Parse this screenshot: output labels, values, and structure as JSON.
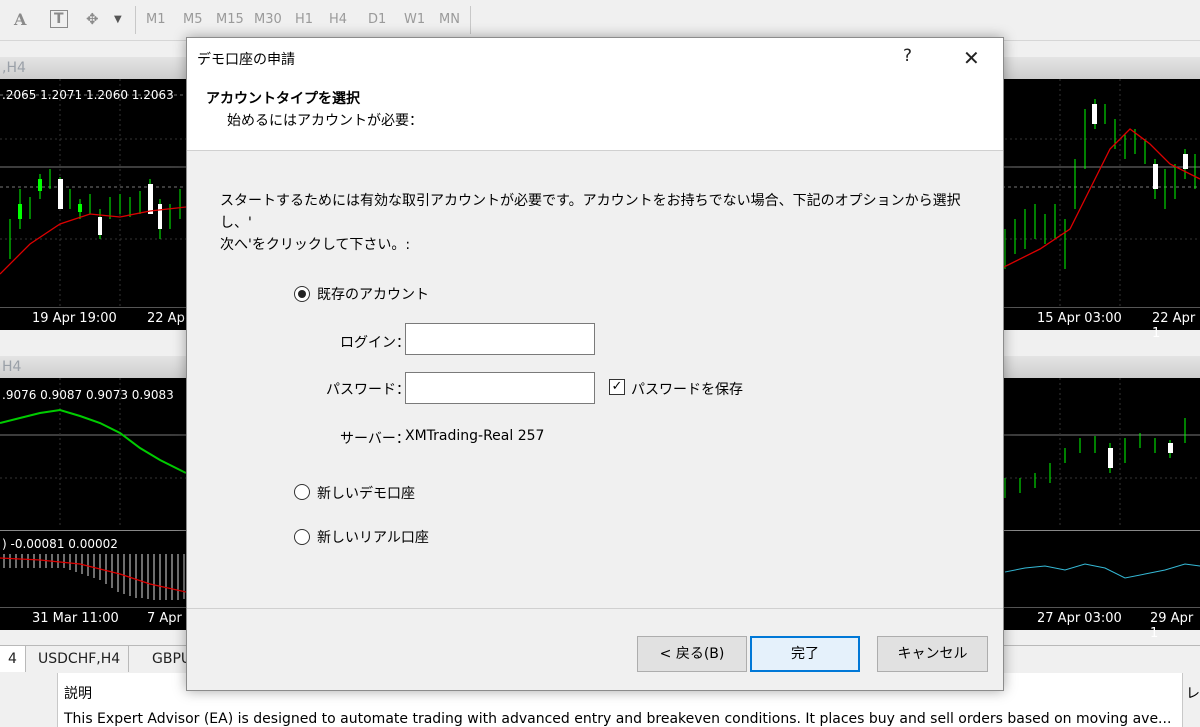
{
  "toolbar": {
    "icons": [
      "text-icon",
      "text-box-icon",
      "shapes-icon",
      "dropdown-icon"
    ],
    "text_glyph": "A",
    "textbox_glyph": "T",
    "timeframes": [
      "M1",
      "M5",
      "M15",
      "M30",
      "H1",
      "H4",
      "D1",
      "W1",
      "MN"
    ]
  },
  "charts": {
    "top": {
      "title": ",H4",
      "ohlc": ".2065 1.2071 1.2060 1.2063",
      "dates_left": [
        "19 Apr 19:00",
        "22 Apr"
      ],
      "dates_right": [
        "15 Apr 03:00",
        "22 Apr 1"
      ]
    },
    "bottom": {
      "title": "H4",
      "ohlc": ".9076 0.9087 0.9073 0.9083",
      "indicator": ") -0.00081 0.00002",
      "dates_left": [
        "31 Mar 11:00",
        "7 Apr 1"
      ],
      "dates_right": [
        "27 Apr 03:00",
        "29 Apr 1"
      ]
    }
  },
  "tabs": [
    "4",
    "USDCHF,H4",
    "GBPU"
  ],
  "bottom_panel": {
    "heading": "説明",
    "text": "This Expert Advisor (EA) is designed to automate trading with advanced entry and breakeven conditions. It places buy and sell orders based on moving ave...",
    "right_label": "レ"
  },
  "dialog": {
    "title": "デモ口座の申請",
    "help": "?",
    "close": "✕",
    "header_title": "アカウントタイプを選択",
    "header_sub": "始めるにはアカウントが必要：",
    "intro_line1": "スタートするためには有効な取引アカウントが必要です。アカウントをお持ちでない場合、下記のオプションから選択し、'",
    "intro_line2": "次へ'をクリックして下さい。:",
    "options": {
      "existing": "既存のアカウント",
      "new_demo": "新しいデモ口座",
      "new_real": "新しいリアル口座"
    },
    "selected_option": "existing",
    "login_label": "ログイン：",
    "login_value": "",
    "password_label": "パスワード：",
    "password_value": "",
    "save_password_label": "パスワードを保存",
    "save_password_checked": true,
    "check_glyph": "✓",
    "server_label": "サーバー：",
    "server_value": "XMTrading-Real 257",
    "buttons": {
      "back": "< 戻る(B)",
      "finish": "完了",
      "cancel": "キャンセル"
    }
  }
}
